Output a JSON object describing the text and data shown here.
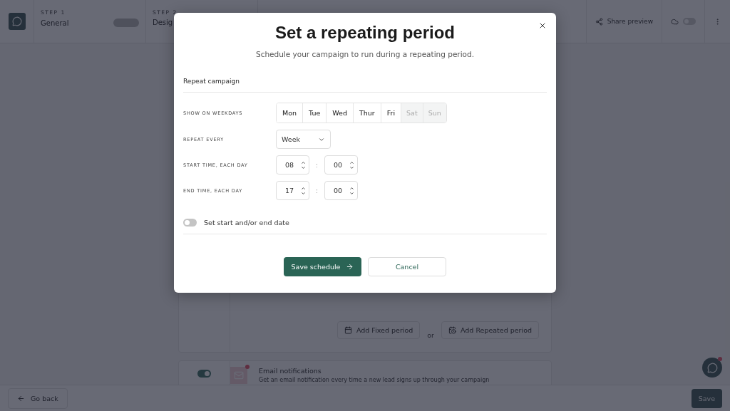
{
  "topbar": {
    "steps": [
      {
        "label": "STEP 1",
        "name": "General"
      },
      {
        "label": "STEP 2",
        "name": "Desig"
      }
    ],
    "share": "Share preview",
    "autosave_on": false
  },
  "schedule_card": {
    "buttons": [
      {
        "kind": "fixed",
        "label": "Add Fixed period"
      },
      {
        "kind": "repeated",
        "label": "Add Repeated period"
      }
    ],
    "separator": "or"
  },
  "notifications_card": {
    "on": true,
    "title": "Email notifications",
    "description": "Get an email notification every time a new lead signs up through your campaign"
  },
  "footer": {
    "back": "Go back",
    "save": "Save"
  },
  "modal": {
    "title": "Set a repeating period",
    "subtitle": "Schedule your campaign to run during a repeating period.",
    "section": "Repeat campaign",
    "weekdays_label": "SHOW ON WEEKDAYS",
    "weekdays": [
      {
        "label": "Mon",
        "selected": true
      },
      {
        "label": "Tue",
        "selected": true
      },
      {
        "label": "Wed",
        "selected": true
      },
      {
        "label": "Thur",
        "selected": true
      },
      {
        "label": "Fri",
        "selected": true
      },
      {
        "label": "Sat",
        "selected": false
      },
      {
        "label": "Sun",
        "selected": false
      }
    ],
    "repeat_label": "REPEAT EVERY",
    "repeat_value": "Week",
    "times": [
      {
        "label": "START TIME, EACH DAY",
        "hour": "08",
        "minute": "00",
        "separator": ":"
      },
      {
        "label": "END TIME, EACH DAY",
        "hour": "17",
        "minute": "00",
        "separator": ":"
      }
    ],
    "date_toggle": {
      "label": "Set start and/or end date",
      "on": false
    },
    "save": "Save schedule",
    "cancel": "Cancel"
  }
}
